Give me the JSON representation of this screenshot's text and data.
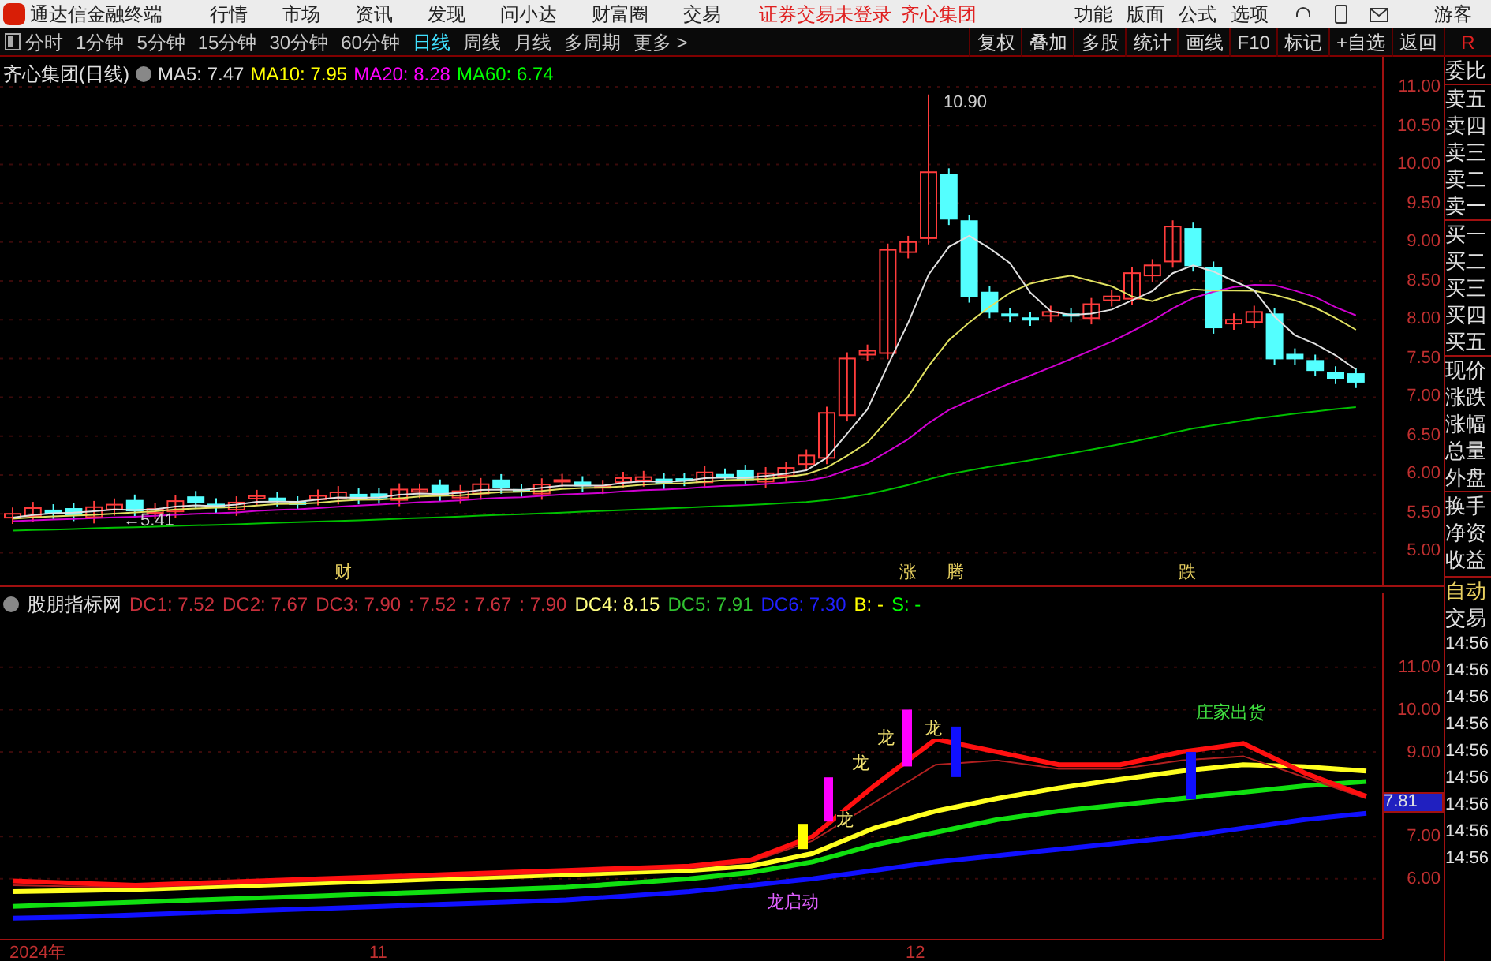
{
  "app": {
    "title": "通达信金融终端",
    "menus": [
      "行情",
      "市场",
      "资讯",
      "发现",
      "问小达",
      "财富圈",
      "交易"
    ],
    "notices": [
      "证券交易未登录",
      "齐心集团"
    ],
    "tools": [
      "功能",
      "版面",
      "公式",
      "选项"
    ],
    "user": "游客"
  },
  "toolbar": {
    "periods": [
      {
        "label": "分时",
        "selected": false
      },
      {
        "label": "1分钟",
        "selected": false
      },
      {
        "label": "5分钟",
        "selected": false
      },
      {
        "label": "15分钟",
        "selected": false
      },
      {
        "label": "30分钟",
        "selected": false
      },
      {
        "label": "60分钟",
        "selected": false
      },
      {
        "label": "日线",
        "selected": true
      },
      {
        "label": "周线",
        "selected": false
      },
      {
        "label": "月线",
        "selected": false
      },
      {
        "label": "多周期",
        "selected": false
      },
      {
        "label": "更多 >",
        "selected": false
      }
    ],
    "buttons": [
      "复权",
      "叠加",
      "多股",
      "统计",
      "画线",
      "F10",
      "标记",
      "+自选",
      "返回"
    ],
    "corner": "R"
  },
  "chart": {
    "title": "齐心集团(日线)",
    "ma": [
      {
        "label": "MA5: 7.47",
        "color": "#dcdcdc"
      },
      {
        "label": "MA10: 7.95",
        "color": "#ffff00"
      },
      {
        "label": "MA20: 8.28",
        "color": "#ff00ff"
      },
      {
        "label": "MA60: 6.74",
        "color": "#00ff00"
      }
    ],
    "price_ticks": [
      "11.00",
      "10.50",
      "10.00",
      "9.50",
      "9.00",
      "8.50",
      "8.00",
      "7.50",
      "7.00",
      "6.50",
      "6.00",
      "5.50",
      "5.00"
    ],
    "high_label": "10.90",
    "low_label": "←5.41",
    "events": [
      "财",
      "涨",
      "腾",
      "跌"
    ]
  },
  "quote_panel": [
    "委比",
    "卖五",
    "卖四",
    "卖三",
    "卖二",
    "卖一",
    "买一",
    "买二",
    "买三",
    "买四",
    "买五",
    "现价",
    "涨跌",
    "涨幅",
    "总量",
    "外盘",
    "换手",
    "净资",
    "收益"
  ],
  "indicator": {
    "name": "股朋指标网",
    "values": [
      {
        "label": "DC1: 7.52",
        "color": "#c8303c"
      },
      {
        "label": "DC2: 7.67",
        "color": "#c8303c"
      },
      {
        "label": "DC3: 7.90",
        "color": "#c8303c"
      },
      {
        "label": ": 7.52",
        "color": "#c8303c"
      },
      {
        "label": ": 7.67",
        "color": "#c8303c"
      },
      {
        "label": ": 7.90",
        "color": "#c8303c"
      },
      {
        "label": "DC4: 8.15",
        "color": "#ffff80"
      },
      {
        "label": "DC5: 7.91",
        "color": "#30c030"
      },
      {
        "label": "DC6: 7.30",
        "color": "#2020ff"
      },
      {
        "label": "B: -",
        "color": "#ffff00"
      },
      {
        "label": "S: -",
        "color": "#00ff00"
      }
    ],
    "current": "7.81",
    "chart_data": {
      "type": "line",
      "ylim": [
        4.58,
        12.75
      ],
      "grid": true,
      "yticks": [
        {
          "value": 11,
          "label": "11.00"
        },
        {
          "value": 10,
          "label": "10.00"
        },
        {
          "value": 9,
          "label": "9.00"
        },
        {
          "value": 7,
          "label": "7.00"
        },
        {
          "value": 6,
          "label": "6.00"
        }
      ],
      "series": [
        {
          "color": "#1010ff",
          "values": [
            5.07,
            5.1,
            5.15,
            5.2,
            5.25,
            5.3,
            5.35,
            5.4,
            5.45,
            5.5,
            5.6,
            5.7,
            5.85,
            6.0,
            6.2,
            6.4,
            6.55,
            6.7,
            6.85,
            7.0,
            7.2,
            7.4,
            7.55
          ]
        },
        {
          "color": "#10e010",
          "values": [
            5.35,
            5.4,
            5.45,
            5.5,
            5.55,
            5.6,
            5.65,
            5.7,
            5.75,
            5.8,
            5.9,
            6.0,
            6.15,
            6.4,
            6.8,
            7.1,
            7.4,
            7.6,
            7.75,
            7.9,
            8.05,
            8.2,
            8.3
          ]
        },
        {
          "color": "#ffff20",
          "values": [
            5.7,
            5.72,
            5.75,
            5.8,
            5.85,
            5.9,
            5.95,
            6.0,
            6.05,
            6.1,
            6.15,
            6.2,
            6.3,
            6.6,
            7.2,
            7.6,
            7.9,
            8.15,
            8.35,
            8.55,
            8.7,
            8.65,
            8.55
          ]
        },
        {
          "color": "#b02020",
          "values": [
            5.85,
            5.82,
            5.8,
            5.85,
            5.9,
            5.95,
            6.0,
            6.05,
            6.1,
            6.15,
            6.2,
            6.25,
            6.4,
            6.9,
            7.8,
            8.7,
            8.8,
            8.6,
            8.6,
            8.8,
            8.9,
            8.4,
            7.9
          ]
        },
        {
          "color": "#ff1010",
          "values": [
            5.95,
            5.9,
            5.85,
            5.9,
            5.95,
            6.0,
            6.05,
            6.1,
            6.15,
            6.2,
            6.25,
            6.3,
            6.45,
            7.0,
            8.2,
            9.3,
            9.0,
            8.7,
            8.7,
            9.0,
            9.2,
            8.5,
            7.95
          ]
        }
      ]
    },
    "signals": [
      "龙",
      "龙",
      "龙",
      "龙",
      "庄家出货",
      "龙启动"
    ]
  },
  "trade_panel": {
    "mode": "自动",
    "title": "交易",
    "times": [
      "14:56",
      "14:56",
      "14:56",
      "14:56",
      "14:56",
      "14:56",
      "14:56",
      "14:56",
      "14:56"
    ]
  },
  "date_axis": [
    "2024年",
    "11",
    "12"
  ]
}
